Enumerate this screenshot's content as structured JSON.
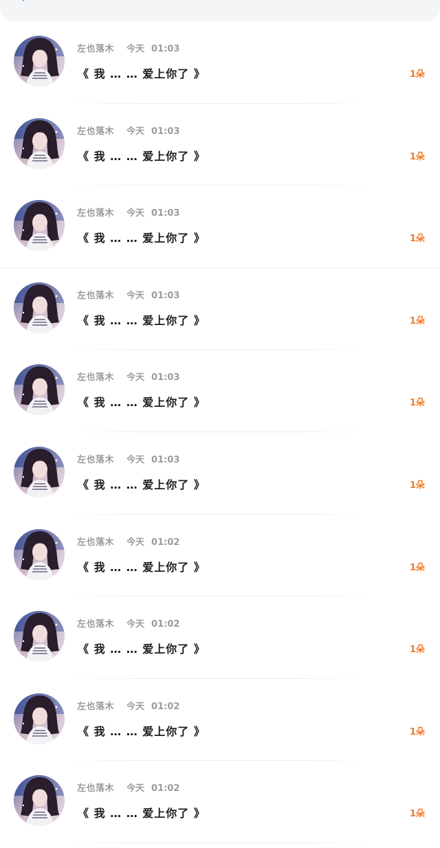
{
  "colors": {
    "accent_count": "#f07a2c",
    "meta_text": "#9b9b9f",
    "title_text": "#1d1d1f",
    "back_icon": "#3d8ff0",
    "topbar_bg": "#f4f5f7"
  },
  "header": {
    "back_icon": "chevron-left-icon"
  },
  "messages": [
    {
      "name": "左也落木",
      "day": "今天",
      "time": "01:03",
      "title": "《 我 … … 爱上你了 》",
      "count": "1朵"
    },
    {
      "name": "左也落木",
      "day": "今天",
      "time": "01:03",
      "title": "《 我 … … 爱上你了 》",
      "count": "1朵"
    },
    {
      "name": "左也落木",
      "day": "今天",
      "time": "01:03",
      "title": "《 我 … … 爱上你了 》",
      "count": "1朵"
    },
    {
      "name": "左也落木",
      "day": "今天",
      "time": "01:03",
      "title": "《 我 … … 爱上你了 》",
      "count": "1朵"
    },
    {
      "name": "左也落木",
      "day": "今天",
      "time": "01:03",
      "title": "《 我 … … 爱上你了 》",
      "count": "1朵"
    },
    {
      "name": "左也落木",
      "day": "今天",
      "time": "01:03",
      "title": "《 我 … … 爱上你了 》",
      "count": "1朵"
    },
    {
      "name": "左也落木",
      "day": "今天",
      "time": "01:02",
      "title": "《 我 … … 爱上你了 》",
      "count": "1朵"
    },
    {
      "name": "左也落木",
      "day": "今天",
      "time": "01:02",
      "title": "《 我 … … 爱上你了 》",
      "count": "1朵"
    },
    {
      "name": "左也落木",
      "day": "今天",
      "time": "01:02",
      "title": "《 我 … … 爱上你了 》",
      "count": "1朵"
    },
    {
      "name": "左也落木",
      "day": "今天",
      "time": "01:02",
      "title": "《 我 … … 爱上你了 》",
      "count": "1朵"
    }
  ]
}
